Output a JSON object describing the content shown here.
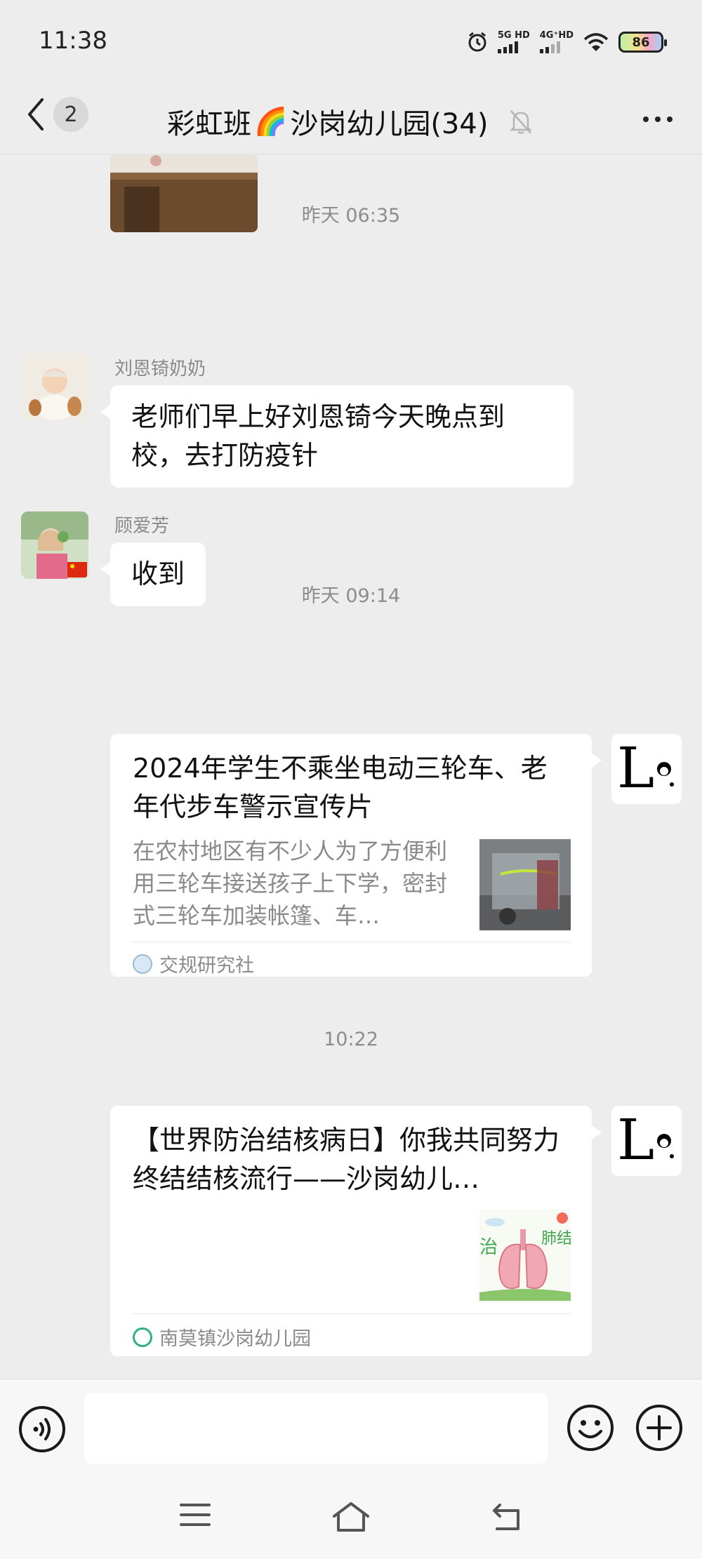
{
  "status_bar": {
    "time": "11:38",
    "sim1_tag": "5G HD",
    "sim2_tag": "4G⁺HD",
    "battery": "86",
    "icons": [
      "alarm-icon",
      "signal-icon",
      "wifi-icon",
      "battery-icon"
    ]
  },
  "nav": {
    "unread_count": "2",
    "title_part1": "彩虹班",
    "title_emoji": "🌈",
    "title_part2": "沙岗幼儿园(34)",
    "icons": [
      "back-icon",
      "mute-icon",
      "more-icon"
    ]
  },
  "messages": {
    "time_1": "昨天 06:35",
    "msg1_sender": "刘恩锜奶奶",
    "msg1_text": "老师们早上好刘恩锜今天晚点到校，去打防疫针",
    "msg2_sender": "顾爱芳",
    "msg2_text": "收到",
    "time_2": "昨天 09:14",
    "card1_title": "2024年学生不乘坐电动三轮车、老年代步车警示宣传片",
    "card1_desc": "在农村地区有不少人为了方便利用三轮车接送孩子上下学，密封式三轮车加装帐篷、车…",
    "card1_source": "交规研究社",
    "time_3": "10:22",
    "card2_title": "【世界防治结核病日】你我共同努力 终结结核流行——沙岗幼儿…",
    "card2_thumb_text_left": "治",
    "card2_thumb_text_right": "肺结",
    "card2_source": "南莫镇沙岗幼儿园",
    "self_avatar_letter": "L"
  },
  "input_bar": {
    "placeholder": "",
    "icons": [
      "voice-icon",
      "emoji-icon",
      "plus-icon"
    ]
  },
  "system_nav": {
    "icons": [
      "menu-icon",
      "home-icon",
      "back-nav-icon"
    ]
  },
  "colors": {
    "background": "#ededed",
    "bubble": "#ffffff",
    "secondary_text": "#8a8a8a"
  }
}
